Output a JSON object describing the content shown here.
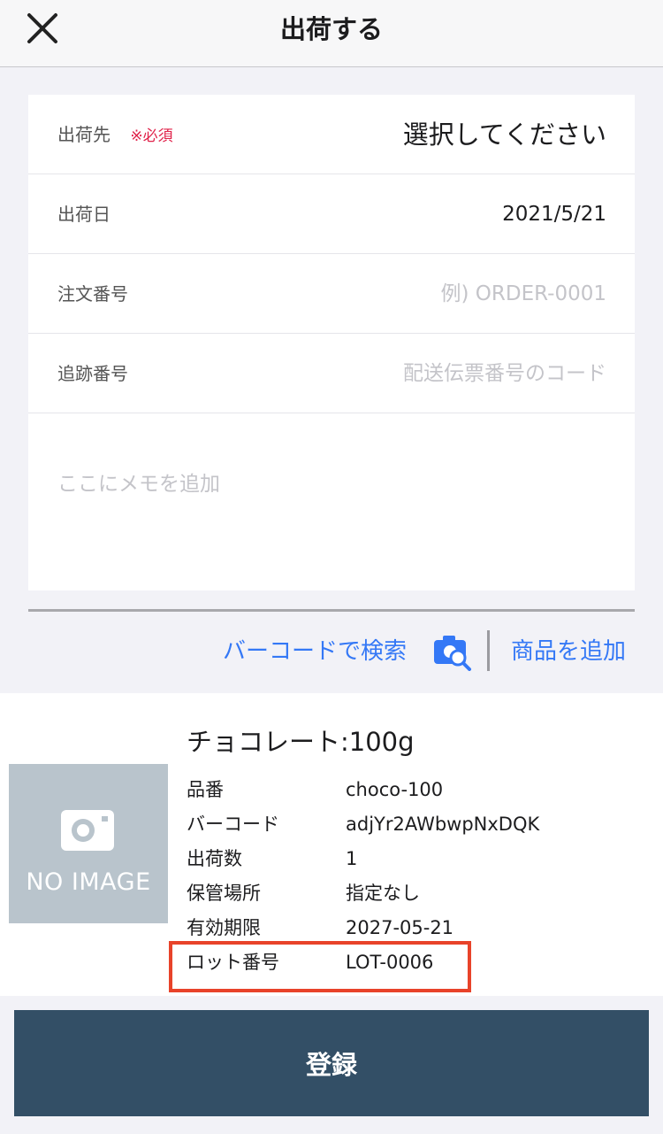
{
  "header": {
    "title": "出荷する",
    "close_icon": "close-icon"
  },
  "form": {
    "destination": {
      "label": "出荷先",
      "required_label": "※必須",
      "value": "選択してください"
    },
    "ship_date": {
      "label": "出荷日",
      "value": "2021/5/21"
    },
    "order_number": {
      "label": "注文番号",
      "placeholder": "例) ORDER-0001",
      "value": ""
    },
    "tracking_number": {
      "label": "追跡番号",
      "placeholder": "配送伝票番号のコード",
      "value": ""
    },
    "memo": {
      "placeholder": "ここにメモを追加",
      "value": ""
    }
  },
  "actions": {
    "barcode_search_label": "バーコードで検索",
    "barcode_icon": "camera-search-icon",
    "add_product_label": "商品を追加",
    "link_color": "#3478f6"
  },
  "product": {
    "image_placeholder": "NO IMAGE",
    "name": "チョコレート:100g",
    "attributes": [
      {
        "label": "品番",
        "value": "choco-100"
      },
      {
        "label": "バーコード",
        "value": "adjYr2AWbwpNxDQK"
      },
      {
        "label": "出荷数",
        "value": "1"
      },
      {
        "label": "保管場所",
        "value": "指定なし"
      },
      {
        "label": "有効期限",
        "value": "2027-05-21"
      },
      {
        "label": "ロット番号",
        "value": "LOT-0006"
      }
    ],
    "highlight_color": "#e8432a"
  },
  "submit": {
    "label": "登録",
    "color": "#334f66"
  }
}
